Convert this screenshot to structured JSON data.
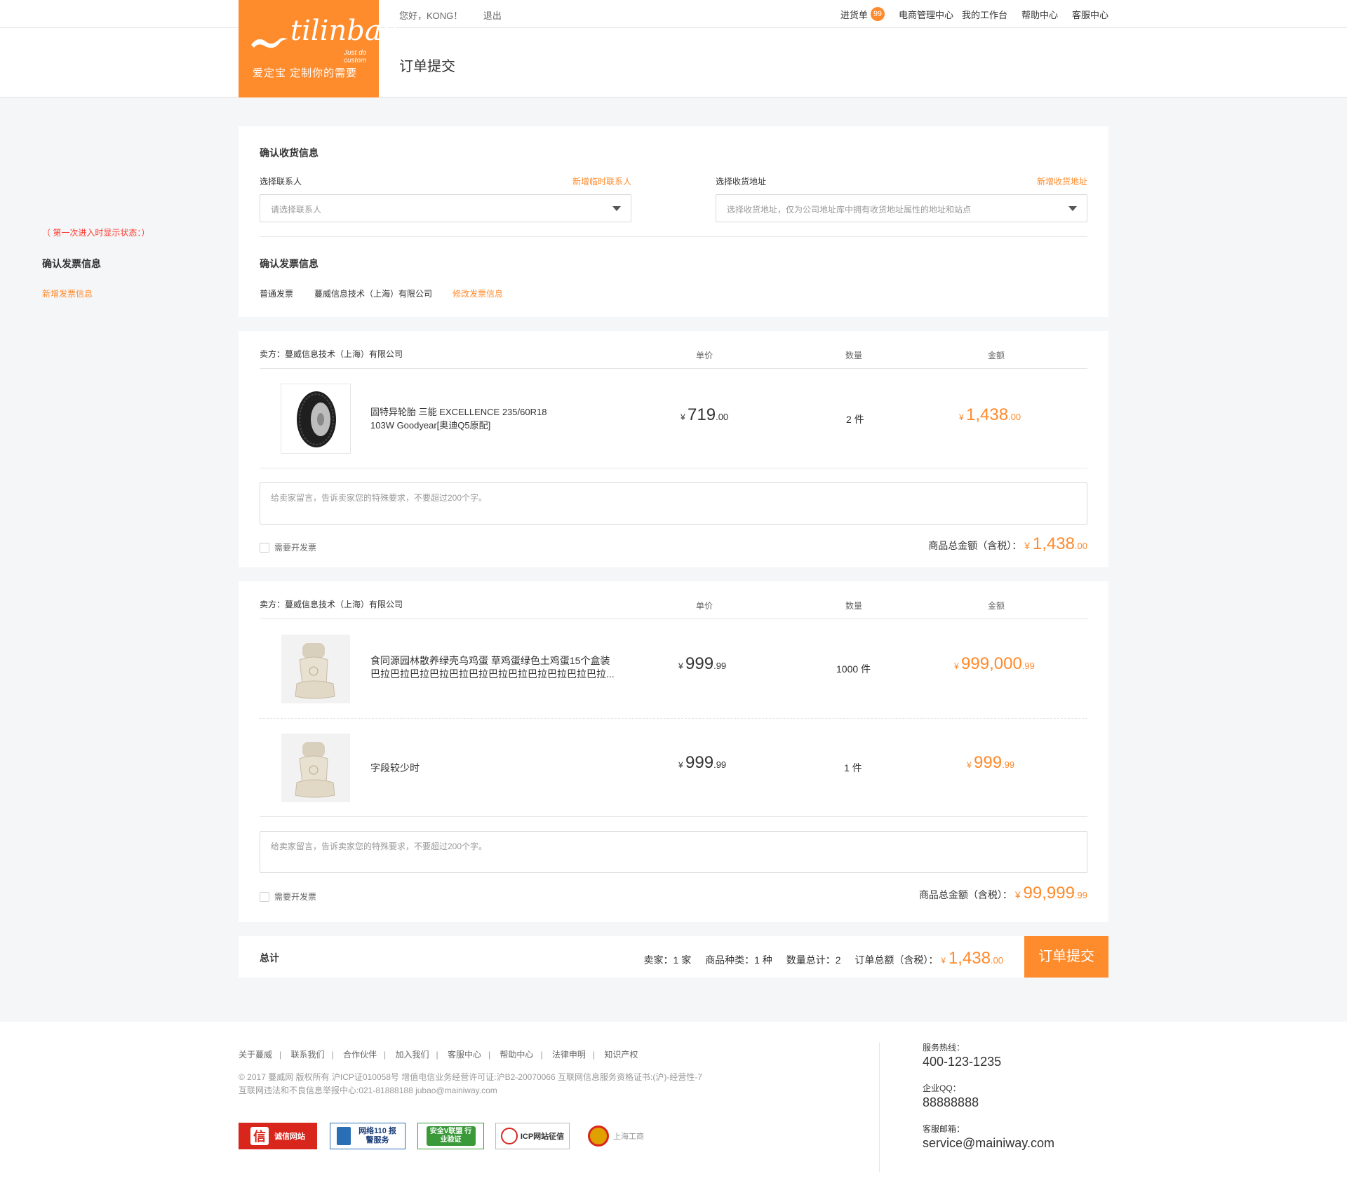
{
  "topbar": {
    "greeting": "您好，KONG！",
    "logout": "退出",
    "purchase_list": "进货单",
    "purchase_badge": "99",
    "ecommerce_center": "电商管理中心",
    "workbench": "我的工作台",
    "help_center": "帮助中心",
    "service_center": "客服中心"
  },
  "logo": {
    "brand": "tilinbao",
    "tagline": "Just do custom",
    "slogan": "爱定宝   定制你的需要"
  },
  "page_title": "订单提交",
  "left_hint": {
    "note": "（ 第一次进入时显示状态：）",
    "title": "确认发票信息",
    "link": "新增发票信息"
  },
  "shipping": {
    "title": "确认收货信息",
    "contact_label": "选择联系人",
    "contact_add": "新增临时联系人",
    "contact_placeholder": "请选择联系人",
    "address_label": "选择收货地址",
    "address_add": "新增收货地址",
    "address_placeholder": "选择收货地址，仅为公司地址库中拥有收货地址属性的地址和站点"
  },
  "invoice": {
    "title": "确认发票信息",
    "type": "普通发票",
    "company": "蔓威信息技术（上海）有限公司",
    "edit": "修改发票信息"
  },
  "orders": [
    {
      "seller": "卖方：蔓威信息技术（上海）有限公司",
      "col_price": "单价",
      "col_qty": "数量",
      "col_amount": "金额",
      "items": [
        {
          "name_line1": "固特异轮胎 三能 EXCELLENCE 235/60R18",
          "name_line2": "103W Goodyear[奥迪Q5原配]",
          "currency": "¥",
          "price_int": "719",
          "price_dec": ".00",
          "qty": "2 件",
          "amount_int": "1,438",
          "amount_dec": ".00"
        }
      ],
      "message_placeholder": "给卖家留言，告诉卖家您的特殊要求，不要超过200个字。",
      "invoice_check": "需要开发票",
      "total_label": "商品总金额（含税）：",
      "total_currency": "¥",
      "total_int": "1,438",
      "total_dec": ".00"
    },
    {
      "seller": "卖方：蔓威信息技术（上海）有限公司",
      "col_price": "单价",
      "col_qty": "数量",
      "col_amount": "金额",
      "items": [
        {
          "name_line1": "食同源园林散养绿壳乌鸡蛋 草鸡蛋绿色土鸡蛋15个盒装",
          "name_line2": "巴拉巴拉巴拉巴拉巴拉巴拉巴拉巴拉巴拉巴拉巴拉巴拉...",
          "currency": "¥",
          "price_int": "999",
          "price_dec": ".99",
          "qty": "1000 件",
          "amount_int": "999,000",
          "amount_dec": ".99"
        },
        {
          "name_line1": "字段较少时",
          "name_line2": "",
          "currency": "¥",
          "price_int": "999",
          "price_dec": ".99",
          "qty": "1 件",
          "amount_int": "999",
          "amount_dec": ".99"
        }
      ],
      "message_placeholder": "给卖家留言，告诉卖家您的特殊要求，不要超过200个字。",
      "invoice_check": "需要开发票",
      "total_label": "商品总金额（含税）：",
      "total_currency": "¥",
      "total_int": "99,999",
      "total_dec": ".99"
    }
  ],
  "summary": {
    "label": "总计",
    "sellers": "卖家：1 家",
    "categories": "商品种类：1 种",
    "quantity": "数量总计：2",
    "total_label": "订单总额（含税）：",
    "currency": "¥",
    "total_int": "1,438",
    "total_dec": ".00",
    "submit": "订单提交"
  },
  "footer": {
    "links": [
      "关于蔓威",
      "联系我们",
      "合作伙伴",
      "加入我们",
      "客服中心",
      "帮助中心",
      "法律申明",
      "知识产权"
    ],
    "copyright": "© 2017 蔓威网 版权所有  沪ICP证010058号   增值电信业务经营许可证:沪B2-20070066     互联网信息服务资格证书:(沪)-经营性-7",
    "report": "互联网违法和不良信息举报中心:021-81888188 jubao@mainiway.com",
    "hotline_label": "服务热线：",
    "hotline": "400-123-1235",
    "qq_label": "企业QQ：",
    "qq": "88888888",
    "email_label": "客服邮箱：",
    "email": "service@mainiway.com",
    "badges": [
      "诚信网站",
      "网络110 报警服务",
      "安全V联盟 行业验证",
      "ICP网站征信",
      "上海工商"
    ],
    "badge_logo_glyph": "信"
  }
}
